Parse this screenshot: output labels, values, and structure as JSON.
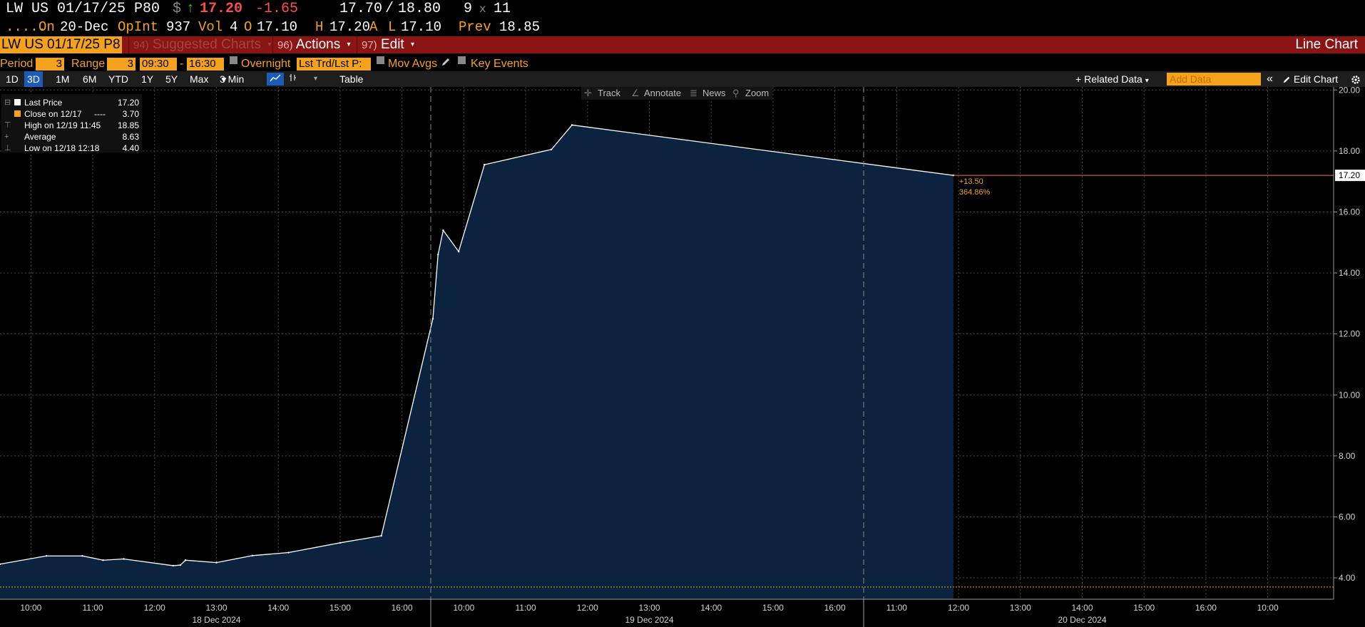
{
  "header": {
    "ticker": "LW US 01/17/25 P80",
    "currency_symbol": "$",
    "arrow": "↑",
    "last": "17.20",
    "change": "-1.65",
    "bid": "17.70",
    "slash": "/",
    "ask": "18.80",
    "size_bid": "9",
    "size_x": "x",
    "size_ask": "11",
    "dots": ".....",
    "on_label": "On",
    "date": "20-Dec",
    "opint_label": "OpInt",
    "opint": "937",
    "vol_label": "Vol",
    "vol": "4",
    "open_label": "O",
    "open": "17.10",
    "high_label": "H",
    "high": "17.20",
    "high_suffix": "A",
    "low_label": "L",
    "low": "17.10",
    "prev_label": "Prev",
    "prev": "18.85"
  },
  "menubar": {
    "ticker": "LW US 01/17/25 P8",
    "suggested": {
      "num": "94)",
      "label": "Suggested Charts"
    },
    "actions": {
      "num": "96)",
      "label": "Actions"
    },
    "edit": {
      "num": "97)",
      "label": "Edit"
    },
    "title": "Line Chart",
    "caret": "▾"
  },
  "settings": {
    "period_label": "Period",
    "period_value": "3",
    "range_label": "Range",
    "range_value": "3",
    "time_start": "09:30",
    "dash": "-",
    "time_end": "16:30",
    "overnight_label": "Overnight",
    "lst_trd": "Lst Trd/Lst P:",
    "mov_avgs_label": "Mov Avgs",
    "key_events_label": "Key Events"
  },
  "toolbar": {
    "ranges": [
      "1D",
      "3D",
      "1M",
      "6M",
      "YTD",
      "1Y",
      "5Y",
      "Max"
    ],
    "selected_range": "3D",
    "interval": "3 Min",
    "interval_caret": "▼",
    "table_label": "Table",
    "related_data": "Related Data",
    "add_data_placeholder": "Add Data",
    "collapse": "«",
    "edit_chart": "Edit Chart"
  },
  "legend": [
    {
      "label": "Last Price",
      "value": "17.20",
      "swatch": "#ffffff",
      "glyph": "⊟"
    },
    {
      "label": "Close on 12/17",
      "value": "3.70",
      "swatch": "#f4a21b",
      "glyph": "",
      "dash": "----"
    },
    {
      "label": "High on 12/19 11:45",
      "value": "18.85",
      "swatch": "",
      "glyph": "⊤"
    },
    {
      "label": "Average",
      "value": "8.63",
      "swatch": "",
      "glyph": "+"
    },
    {
      "label": "Low on 12/18 12:18",
      "value": "4.40",
      "swatch": "",
      "glyph": "⊥"
    }
  ],
  "tools": {
    "track": "Track",
    "annotate": "Annotate",
    "news": "News",
    "zoom": "Zoom"
  },
  "chart_data": {
    "type": "area",
    "series": [
      {
        "name": "Last Price",
        "x": [
          "12/18 09:30",
          "12/18 10:15",
          "12/18 10:50",
          "12/18 11:10",
          "12/18 11:30",
          "12/18 12:18",
          "12/18 12:25",
          "12/18 12:30",
          "12/18 13:00",
          "12/18 13:35",
          "12/18 14:10",
          "12/18 15:00",
          "12/18 15:40",
          "12/19 09:30",
          "12/19 09:35",
          "12/19 09:40",
          "12/19 09:55",
          "12/19 10:20",
          "12/19 11:25",
          "12/19 11:45",
          "12/20 10:55"
        ],
        "y": [
          4.45,
          4.72,
          4.72,
          4.58,
          4.62,
          4.4,
          4.42,
          4.58,
          4.5,
          4.73,
          4.83,
          5.15,
          5.38,
          12.5,
          14.6,
          15.4,
          14.7,
          17.55,
          18.05,
          18.85,
          17.2
        ]
      }
    ],
    "reference_line": {
      "name": "Close on 12/17",
      "value": 3.7,
      "color": "#f4a21b"
    },
    "last_value": 17.2,
    "last_color": "#ff6b50",
    "change_label": "+13.50",
    "change_pct_label": "364.86%",
    "ylim": [
      3.3,
      20.1
    ],
    "yticks": [
      4.0,
      6.0,
      8.0,
      10.0,
      12.0,
      14.0,
      16.0,
      18.0,
      20.0
    ],
    "ytick_labels": [
      "4.00",
      "6.00",
      "8.00",
      "10.00",
      "12.00",
      "14.00",
      "16.00",
      "18.00",
      "20.00"
    ],
    "xtick_labels": [
      "10:00",
      "11:00",
      "12:00",
      "13:00",
      "14:00",
      "15:00",
      "16:00",
      "10:00",
      "11:00",
      "12:00",
      "13:00",
      "14:00",
      "15:00",
      "16:00",
      "11:00",
      "12:00",
      "13:00",
      "14:00",
      "15:00",
      "16:00",
      "10:00"
    ],
    "day_labels": [
      "18 Dec 2024",
      "19 Dec 2024",
      "20 Dec 2024"
    ],
    "days": [
      "12/18",
      "12/19",
      "12/20"
    ],
    "session": [
      "09:30",
      "16:30"
    ],
    "grid": true,
    "area_color": "#0c2340",
    "line_color": "#ffffff"
  }
}
